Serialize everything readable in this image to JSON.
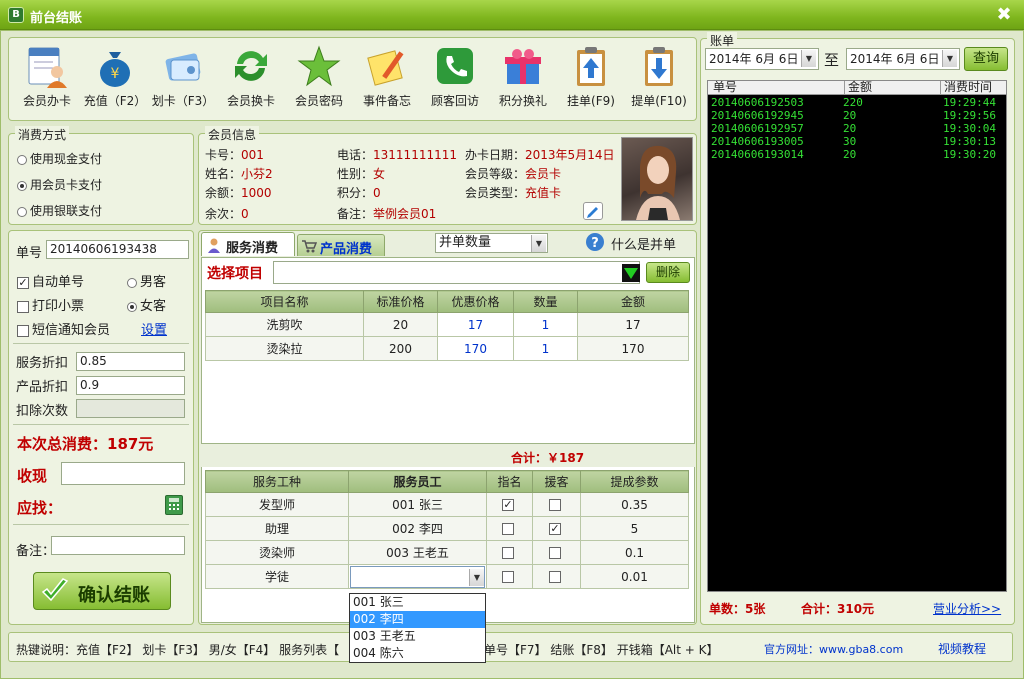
{
  "window": {
    "title": "前台结账",
    "app_icon": "B",
    "close_glyph": "✖"
  },
  "toolbar": [
    {
      "label": "会员办卡",
      "icon": "member-card-icon"
    },
    {
      "label": "充值（F2）",
      "icon": "money-bag-icon"
    },
    {
      "label": "划卡（F3）",
      "icon": "swipe-card-icon"
    },
    {
      "label": "会员换卡",
      "icon": "refresh-icon"
    },
    {
      "label": "会员密码",
      "icon": "star-icon"
    },
    {
      "label": "事件备忘",
      "icon": "memo-icon"
    },
    {
      "label": "顾客回访",
      "icon": "phone-icon"
    },
    {
      "label": "积分换礼",
      "icon": "gift-icon"
    },
    {
      "label": "挂单(F9)",
      "icon": "clipboard-up-icon"
    },
    {
      "label": "提单(F10)",
      "icon": "clipboard-down-icon"
    }
  ],
  "payment": {
    "legend": "消费方式",
    "options": [
      {
        "label": "使用现金支付",
        "selected": false
      },
      {
        "label": "用会员卡支付",
        "selected": true
      },
      {
        "label": "使用银联支付",
        "selected": false
      }
    ]
  },
  "member": {
    "legend": "会员信息",
    "card_no_label": "卡号：",
    "card_no": "001",
    "phone_label": "电话：",
    "phone": "13111111111",
    "open_date_label": "办卡日期：",
    "open_date": "2013年5月14日",
    "name_label": "姓名：",
    "name": "小芬2",
    "gender_label": "性别：",
    "gender": "女",
    "level_label": "会员等级：",
    "level": "会员卡",
    "balance_label": "余额：",
    "balance": "1000",
    "points_label": "积分：",
    "points": "0",
    "type_label": "会员类型：",
    "type": "充值卡",
    "times_label": "余次：",
    "times": "0",
    "note_label": "备注：",
    "note": "举例会员01"
  },
  "order": {
    "order_no_label": "单号",
    "order_no": "20140606193438",
    "auto_no_label": "自动单号",
    "auto_no": true,
    "print_label": "打印小票",
    "print": false,
    "sms_label": "短信通知会员",
    "sms": false,
    "male_label": "男客",
    "female_label": "女客",
    "gender_selected": "female",
    "settings_label": "设置",
    "service_discount_label": "服务折扣",
    "service_discount": "0.85",
    "product_discount_label": "产品折扣",
    "product_discount": "0.9",
    "deduct_times_label": "扣除次数",
    "deduct_times": "",
    "total_label": "本次总消费：187元",
    "received_label": "收现",
    "change_label": "应找：",
    "remark_label": "备注：",
    "confirm_label": "确认结账"
  },
  "tabs": [
    {
      "label": "服务消费",
      "active": true
    },
    {
      "label": "产品消费",
      "active": false
    }
  ],
  "merge": {
    "select_value": "并单数量",
    "help_label": "什么是并单"
  },
  "select_item": {
    "label": "选择项目",
    "value": "",
    "delete_label": "删除"
  },
  "service_table": {
    "headers": [
      "项目名称",
      "标准价格",
      "优惠价格",
      "数量",
      "金额"
    ],
    "rows": [
      [
        "洗剪吹",
        "20",
        "17",
        "1",
        "17"
      ],
      [
        "烫染拉",
        "200",
        "170",
        "1",
        "170"
      ]
    ],
    "total_label": "合计：￥187"
  },
  "staff_table": {
    "headers": [
      "服务工种",
      "服务员工",
      "指名",
      "援客",
      "提成参数"
    ],
    "rows": [
      {
        "role": "发型师",
        "staff": "001 张三",
        "named": true,
        "assist": false,
        "param": "0.35"
      },
      {
        "role": "助理",
        "staff": "002 李四",
        "named": false,
        "assist": true,
        "param": "5"
      },
      {
        "role": "烫染师",
        "staff": "003 王老五",
        "named": false,
        "assist": false,
        "param": "0.1"
      },
      {
        "role": "学徒",
        "staff": "",
        "named": false,
        "assist": false,
        "param": "0.01"
      }
    ],
    "dropdown_options": [
      "001 张三",
      "002 李四",
      "003 王老五",
      "004 陈六"
    ],
    "dropdown_highlight": 1
  },
  "bills": {
    "legend": "账单",
    "date_from": "2014年  6月  6日",
    "to_label": "至",
    "date_to": "2014年  6月  6日",
    "query_label": "查询",
    "headers": [
      "单号",
      "金额",
      "消费时间"
    ],
    "rows": [
      [
        "20140606192503",
        "220",
        "19:29:44"
      ],
      [
        "20140606192945",
        "20",
        "19:29:56"
      ],
      [
        "20140606192957",
        "20",
        "19:30:04"
      ],
      [
        "20140606193005",
        "30",
        "19:30:13"
      ],
      [
        "20140606193014",
        "20",
        "19:30:20"
      ]
    ],
    "count_label": "单数：5张",
    "sum_label": "合计：310元",
    "analysis_label": "营业分析>>"
  },
  "statusbar": {
    "hotkeys_left": "热键说明：充值【F2】  划卡【F3】  男/女【F4】  服务列表【",
    "hotkeys_right": "单号【F7】 结账【F8】 开钱箱【Alt + K】",
    "site_label": "官方网址：www.gba8.com",
    "video_label": "视频教程"
  },
  "colors": {
    "title_green": "#7fb61e",
    "accent_red": "#c00000",
    "bill_text": "#35e035"
  }
}
